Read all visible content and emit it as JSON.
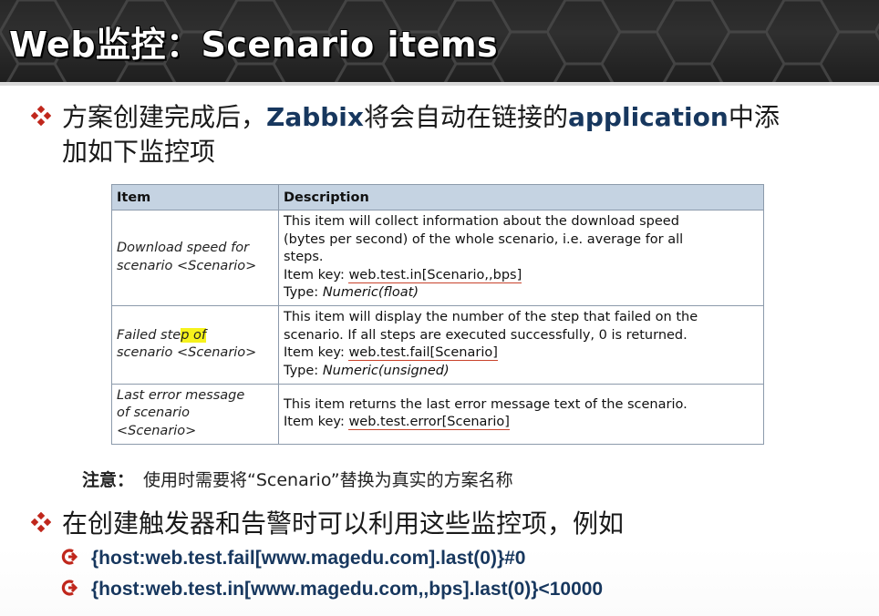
{
  "header": {
    "title": "Web监控：Scenario items"
  },
  "bullets": [
    {
      "parts": [
        "方案创建完成后，",
        "Zabbix",
        "将会自动在链接的",
        "application",
        "中添"
      ],
      "line2": "加如下监控项"
    },
    {
      "text": "在创建触发器和告警时可以利用这些监控项，例如"
    }
  ],
  "table": {
    "headers": [
      "Item",
      "Description"
    ],
    "rows": [
      {
        "item_lines": [
          "Download speed for",
          "scenario <Scenario>"
        ],
        "desc_lines": [
          "This item will collect information about the download speed",
          "(bytes per second) of the whole scenario, i.e. average for all",
          "steps."
        ],
        "key_label": "Item key: ",
        "key": "web.test.in[Scenario,,bps]",
        "type_label": "Type: ",
        "type": "Numeric(float)"
      },
      {
        "item_lines_a": "Failed ste",
        "item_mark": "p of",
        "item_lines_b": "scenario <Scenario>",
        "desc_lines": [
          "This item will display the number of the step that failed on the",
          "scenario. If all steps are executed successfully, 0 is returned."
        ],
        "key_label": "Item key: ",
        "key": "web.test.fail[Scenario]",
        "type_label": "Type: ",
        "type": "Numeric(unsigned)"
      },
      {
        "item_lines": [
          "Last error message",
          "of scenario",
          "<Scenario>"
        ],
        "desc_lines": [
          "This item returns the last error message text of the scenario."
        ],
        "key_label": "Item key: ",
        "key": "web.test.error[Scenario]"
      }
    ]
  },
  "note": {
    "label": "注意：",
    "body": "使用时需要将“Scenario”替换为真实的方案名称"
  },
  "examples": [
    "{host:web.test.fail[www.magedu.com].last(0)}#0",
    "{host:web.test.in[www.magedu.com,,bps].last(0)}<10000"
  ],
  "colors": {
    "accent_red": "#c0271c",
    "text_blue": "#17375e",
    "table_header": "#c5d3e2",
    "highlight": "#f6f21c"
  }
}
